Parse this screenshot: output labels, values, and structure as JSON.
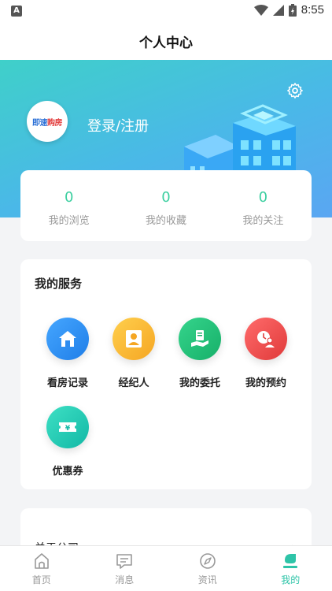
{
  "status": {
    "time": "8:55",
    "app_badge": "A"
  },
  "header": {
    "title": "个人中心"
  },
  "profile": {
    "login_text": "登录/注册",
    "avatar_text": "即速",
    "avatar_text_red": "购房"
  },
  "stats": [
    {
      "value": "0",
      "label": "我的浏览"
    },
    {
      "value": "0",
      "label": "我的收藏"
    },
    {
      "value": "0",
      "label": "我的关注"
    }
  ],
  "services": {
    "title": "我的服务",
    "items": [
      {
        "label": "看房记录",
        "icon": "house-icon",
        "color": "#2d8cf0"
      },
      {
        "label": "经纪人",
        "icon": "agent-icon",
        "color": "#f7b731"
      },
      {
        "label": "我的委托",
        "icon": "entrust-icon",
        "color": "#20c07a"
      },
      {
        "label": "我的预约",
        "icon": "appointment-icon",
        "color": "#ea4a4a"
      },
      {
        "label": "优惠券",
        "icon": "coupon-icon",
        "color": "#22cbb5"
      }
    ]
  },
  "about": {
    "label": "关于公司"
  },
  "tabs": [
    {
      "label": "首页",
      "icon": "home-icon"
    },
    {
      "label": "消息",
      "icon": "message-icon"
    },
    {
      "label": "资讯",
      "icon": "compass-icon"
    },
    {
      "label": "我的",
      "icon": "profile-icon",
      "active": true
    }
  ],
  "colors": {
    "accent": "#2ec4a8",
    "stat_number": "#3ccfa0"
  }
}
